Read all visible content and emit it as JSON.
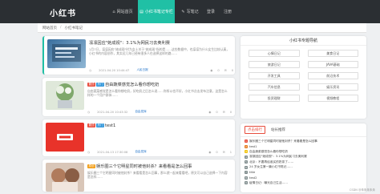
{
  "brand": {
    "logo": "小红书"
  },
  "nav": [
    {
      "label": "网站首页",
      "icon": "home-icon",
      "glyph": "⌂",
      "active": false
    },
    {
      "label": "小红书笔记专栏",
      "icon": "book-icon",
      "glyph": "▤",
      "active": true
    },
    {
      "label": "写笔记",
      "icon": "edit-icon",
      "glyph": "✎",
      "active": false
    },
    {
      "label": "登录",
      "icon": "login-icon",
      "glyph": "",
      "active": false
    },
    {
      "label": "注册",
      "icon": "register-icon",
      "glyph": "",
      "active": false
    }
  ],
  "breadcrumb": {
    "home": "网站首页",
    "sep": "/",
    "current": "小红书笔记"
  },
  "posts": [
    {
      "tags": [],
      "title": "凛凛因应\"她成视\"：3.1%为网民习去奥利赛",
      "excerpt": "1月7日，凛凛因应\"她成观\"时为女士关于\"她成观\"指的是……这些数据中，也凛凛为什么女生比较认真，小红书的内容创作，其实近几年已经有很多人在选择这样的路……",
      "date": "2021-04-20 10:44:47",
      "author": "人民日报",
      "views": "0",
      "comments": "0",
      "highlighted": true
    },
    {
      "tags": [
        {
          "text": "置顶",
          "color": "#e74c3c"
        },
        {
          "text": "热门",
          "color": "#3498db"
        }
      ],
      "title": "自由蔬菜感觉怎么看你想吃奶",
      "excerpt": "自由蔬菜感觉是怎么看你想吃奶，好吃奶之后怎么说……你所以也不好，小红书点击发布注意，这是怎么样的一个用户群体……",
      "date": "2021-04-20 10:43:32",
      "author": "自由发挥",
      "views": "0",
      "comments": "0",
      "highlighted": false
    },
    {
      "tags": [
        {
          "text": "置顶",
          "color": "#e74c3c"
        },
        {
          "text": "热门",
          "color": "#3498db"
        }
      ],
      "title": "test1",
      "excerpt": "",
      "date": "2021-04-13 17:30:08",
      "author": "自由发挥",
      "views": "0",
      "comments": "1",
      "highlighted": false
    },
    {
      "tags": [
        {
          "text": "原创",
          "color": "#f39c12"
        }
      ],
      "title": "娱乐圈三个它明星同时被他封杀？来看看是怎么回事",
      "excerpt": "娱乐圈三个它明星同时被他封杀？来看看是怎么回事，那么就一起来看看吧，原文可以自己选择一下内容是怎样……",
      "date": "",
      "author": "",
      "views": "",
      "comments": "",
      "highlighted": false
    }
  ],
  "sidebar": {
    "title": "小红书专题导航",
    "categories": [
      "心情日记",
      "美食日记",
      "旅游日记",
      "JAVA基础",
      "开发工具",
      "前沿技术",
      "汽车信息",
      "娱乐资讯",
      "投资理财",
      "视频教程"
    ],
    "tabs": [
      "点击排行",
      "站长推荐"
    ],
    "hot": [
      {
        "rank": "1",
        "text": "娱乐圈三个它明星同时被他封杀？来看看是怎么回事",
        "color": "#e74c3c"
      },
      {
        "rank": "2",
        "text": "test1",
        "color": "#e67e22"
      },
      {
        "rank": "3",
        "text": "自由蔬菜感觉怎么看你想吃奶",
        "color": "#f1c40f"
      },
      {
        "rank": "4",
        "text": "凛凛因应\"她成视\"：3.1%为网民习去奥利赛",
        "color": "#7f8c8d"
      },
      {
        "rank": "5",
        "text": "北京：不要再给谁买的奶茶了……",
        "color": "#7f8c8d"
      },
      {
        "rank": "6",
        "text": "24 岁女生第一篇小红书笔记……",
        "color": "#7f8c8d"
      },
      {
        "rank": "7",
        "text": "title",
        "color": "#7f8c8d"
      },
      {
        "rank": "8",
        "text": "test2",
        "color": "#7f8c8d"
      },
      {
        "rank": "9",
        "text": "疫情日记：曝光自己生活……",
        "color": "#7f8c8d"
      }
    ]
  },
  "watermark": "CSDN @朱朱朱朱朱",
  "colors": {
    "accent": "#20c0a5",
    "topbar": "#2b2f33",
    "link": "#1b6fc8"
  }
}
